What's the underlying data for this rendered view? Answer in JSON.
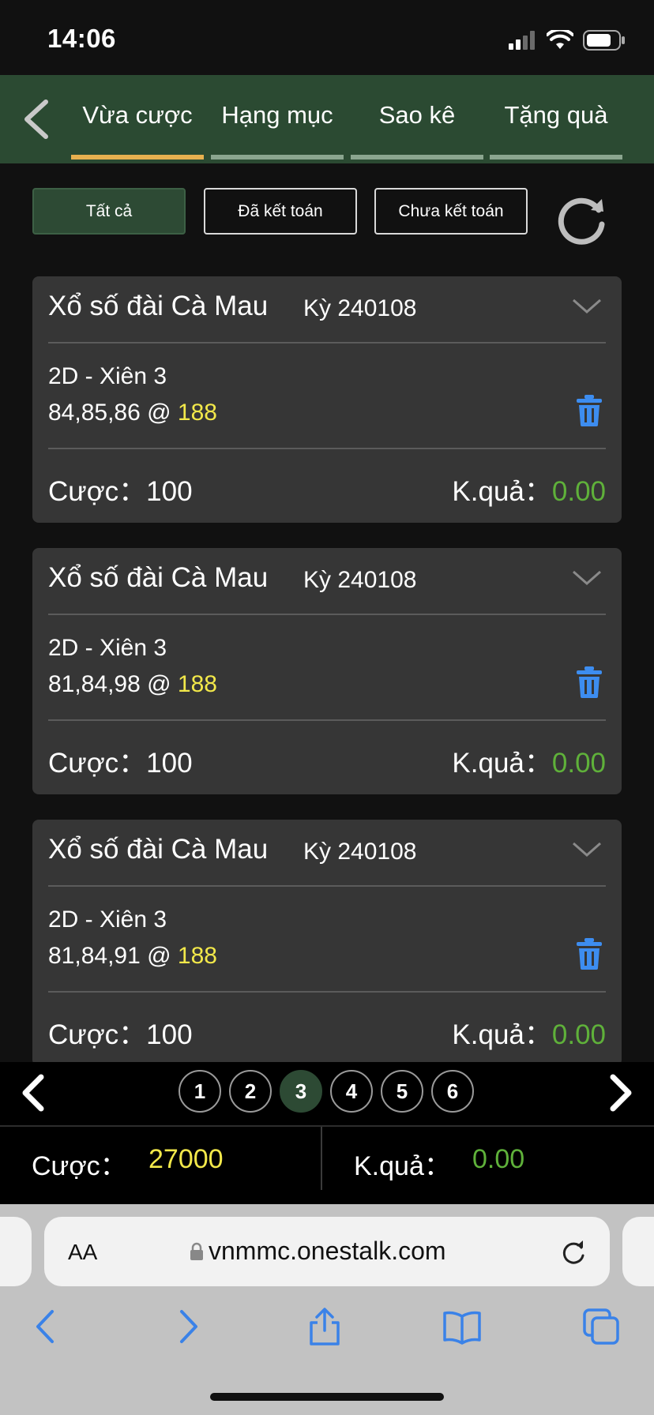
{
  "status": {
    "time": "14:06"
  },
  "nav": {
    "tabs": [
      {
        "label": "Vừa cược",
        "active": true
      },
      {
        "label": "Hạng mục",
        "active": false
      },
      {
        "label": "Sao kê",
        "active": false
      },
      {
        "label": "Tặng quà",
        "active": false
      }
    ]
  },
  "filters": [
    {
      "label": "Tất cả",
      "active": true
    },
    {
      "label": "Đã kết toán",
      "active": false
    },
    {
      "label": "Chưa kết toán",
      "active": false
    }
  ],
  "cards": [
    {
      "title": "Xổ số đài Cà Mau",
      "period": "Kỳ 240108",
      "type": "2D - Xiên 3",
      "numbers": "84,85,86 @ ",
      "odds": "188",
      "bet_label": "Cược：",
      "bet": "100",
      "result_label": "K.quả：",
      "result": "0.00"
    },
    {
      "title": "Xổ số đài Cà Mau",
      "period": "Kỳ 240108",
      "type": "2D - Xiên 3",
      "numbers": "81,84,98 @ ",
      "odds": "188",
      "bet_label": "Cược：",
      "bet": "100",
      "result_label": "K.quả：",
      "result": "0.00"
    },
    {
      "title": "Xổ số đài Cà Mau",
      "period": "Kỳ 240108",
      "type": "2D - Xiên 3",
      "numbers": "81,84,91 @ ",
      "odds": "188",
      "bet_label": "Cược：",
      "bet": "100",
      "result_label": "K.quả：",
      "result": "0.00"
    }
  ],
  "pagination": {
    "pages": [
      "1",
      "2",
      "3",
      "4",
      "5",
      "6"
    ],
    "current": "3"
  },
  "totals": {
    "bet_label": "Cược：",
    "bet_value": "27000",
    "result_label": "K.quả：",
    "result_value": "0.00"
  },
  "browser": {
    "aa_label": "AA",
    "url": "vnmmc.onestalk.com"
  },
  "colors": {
    "nav_bg": "#2b4a32",
    "active_tab_underline": "#e7b04f",
    "odds_yellow": "#f2e84a",
    "result_green": "#5fb13a",
    "trash_blue": "#3d8df0"
  }
}
